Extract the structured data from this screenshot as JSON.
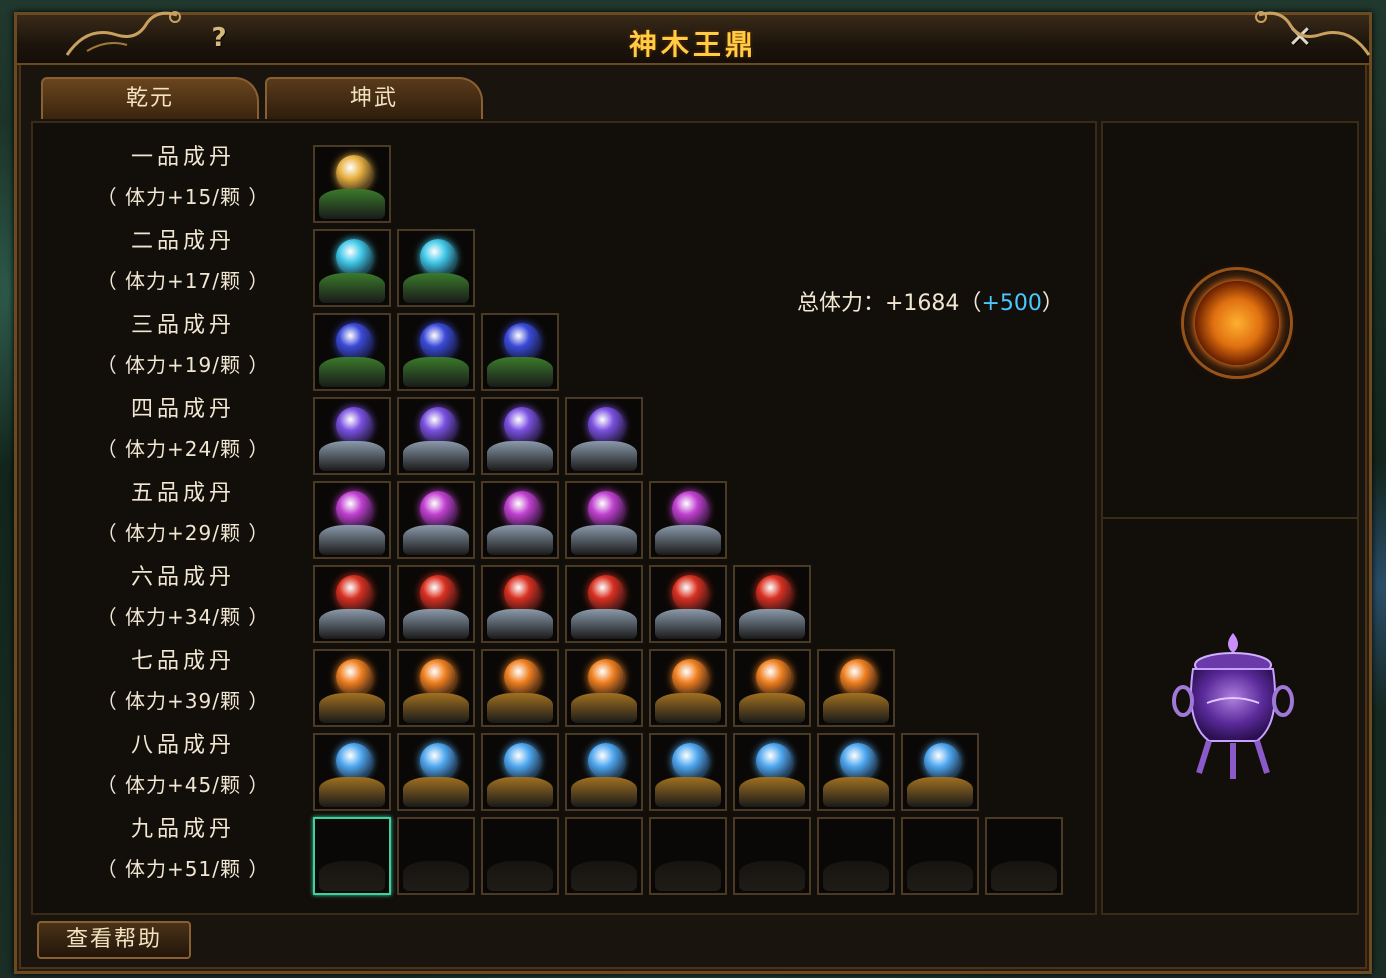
{
  "window": {
    "title": "神木王鼎",
    "help_icon": "?",
    "close_icon": "✕"
  },
  "tabs": [
    {
      "label": "乾元"
    },
    {
      "label": "坤武"
    }
  ],
  "rows": [
    {
      "name": "一品成丹",
      "bonus": "（ 体力+15/颗 ）",
      "filled": 1,
      "total": 1,
      "color": "#e8b040"
    },
    {
      "name": "二品成丹",
      "bonus": "（ 体力+17/颗 ）",
      "filled": 2,
      "total": 2,
      "color": "#40c8e8"
    },
    {
      "name": "三品成丹",
      "bonus": "（ 体力+19/颗 ）",
      "filled": 3,
      "total": 3,
      "color": "#3a4ad8"
    },
    {
      "name": "四品成丹",
      "bonus": "（ 体力+24/颗 ）",
      "filled": 4,
      "total": 4,
      "color": "#7a50e0"
    },
    {
      "name": "五品成丹",
      "bonus": "（ 体力+29/颗 ）",
      "filled": 5,
      "total": 5,
      "color": "#c040d0"
    },
    {
      "name": "六品成丹",
      "bonus": "（ 体力+34/颗 ）",
      "filled": 6,
      "total": 6,
      "color": "#d83020"
    },
    {
      "name": "七品成丹",
      "bonus": "（ 体力+39/颗 ）",
      "filled": 7,
      "total": 7,
      "color": "#f08020"
    },
    {
      "name": "八品成丹",
      "bonus": "（ 体力+45/颗 ）",
      "filled": 8,
      "total": 8,
      "color": "#50a8f0"
    },
    {
      "name": "九品成丹",
      "bonus": "（ 体力+51/颗 ）",
      "filled": 0,
      "total": 9,
      "color": "#000000"
    }
  ],
  "total_stat": {
    "label": "总体力：+1684（",
    "bonus": "+500",
    "close": "）"
  },
  "help_button": {
    "label": "查看帮助"
  },
  "colors": {
    "selected_border": "#3fd0a0",
    "title": "#ffcc44",
    "bonus_blue": "#4ac8ff"
  }
}
